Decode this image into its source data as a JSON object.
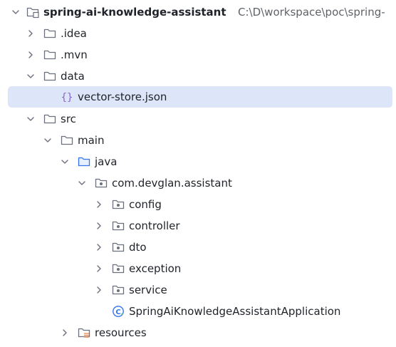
{
  "project": {
    "name": "spring-ai-knowledge-assistant",
    "path": "C:\\D\\workspace\\poc\\spring-"
  },
  "tree": [
    {
      "label": "spring-ai-knowledge-assistant",
      "icon": "project-folder-icon",
      "state": "expanded",
      "depth": 0,
      "bold": true
    },
    {
      "label": ".idea",
      "icon": "folder-icon",
      "state": "collapsed",
      "depth": 1
    },
    {
      "label": ".mvn",
      "icon": "folder-icon",
      "state": "collapsed",
      "depth": 1
    },
    {
      "label": "data",
      "icon": "folder-icon",
      "state": "expanded",
      "depth": 1
    },
    {
      "label": "vector-store.json",
      "icon": "json-file-icon",
      "state": "leaf",
      "depth": 2,
      "selected": true
    },
    {
      "label": "src",
      "icon": "folder-icon",
      "state": "expanded",
      "depth": 1
    },
    {
      "label": "main",
      "icon": "folder-icon",
      "state": "expanded",
      "depth": 2
    },
    {
      "label": "java",
      "icon": "source-root-folder-icon",
      "state": "expanded",
      "depth": 3
    },
    {
      "label": "com.devglan.assistant",
      "icon": "package-icon",
      "state": "expanded",
      "depth": 4
    },
    {
      "label": "config",
      "icon": "package-icon",
      "state": "collapsed",
      "depth": 5
    },
    {
      "label": "controller",
      "icon": "package-icon",
      "state": "collapsed",
      "depth": 5
    },
    {
      "label": "dto",
      "icon": "package-icon",
      "state": "collapsed",
      "depth": 5
    },
    {
      "label": "exception",
      "icon": "package-icon",
      "state": "collapsed",
      "depth": 5
    },
    {
      "label": "service",
      "icon": "package-icon",
      "state": "collapsed",
      "depth": 5
    },
    {
      "label": "SpringAiKnowledgeAssistantApplication",
      "icon": "spring-boot-app-icon",
      "state": "leaf",
      "depth": 5
    },
    {
      "label": "resources",
      "icon": "resources-folder-icon",
      "state": "collapsed",
      "depth": 3
    }
  ],
  "colors": {
    "selection": "#dde6f8",
    "folder_stroke": "#6c707e",
    "source_root_stroke": "#3574f0",
    "json_braces": "#8a63d2",
    "spring_app": "#3574f0",
    "resources_lines": "#e08855"
  }
}
